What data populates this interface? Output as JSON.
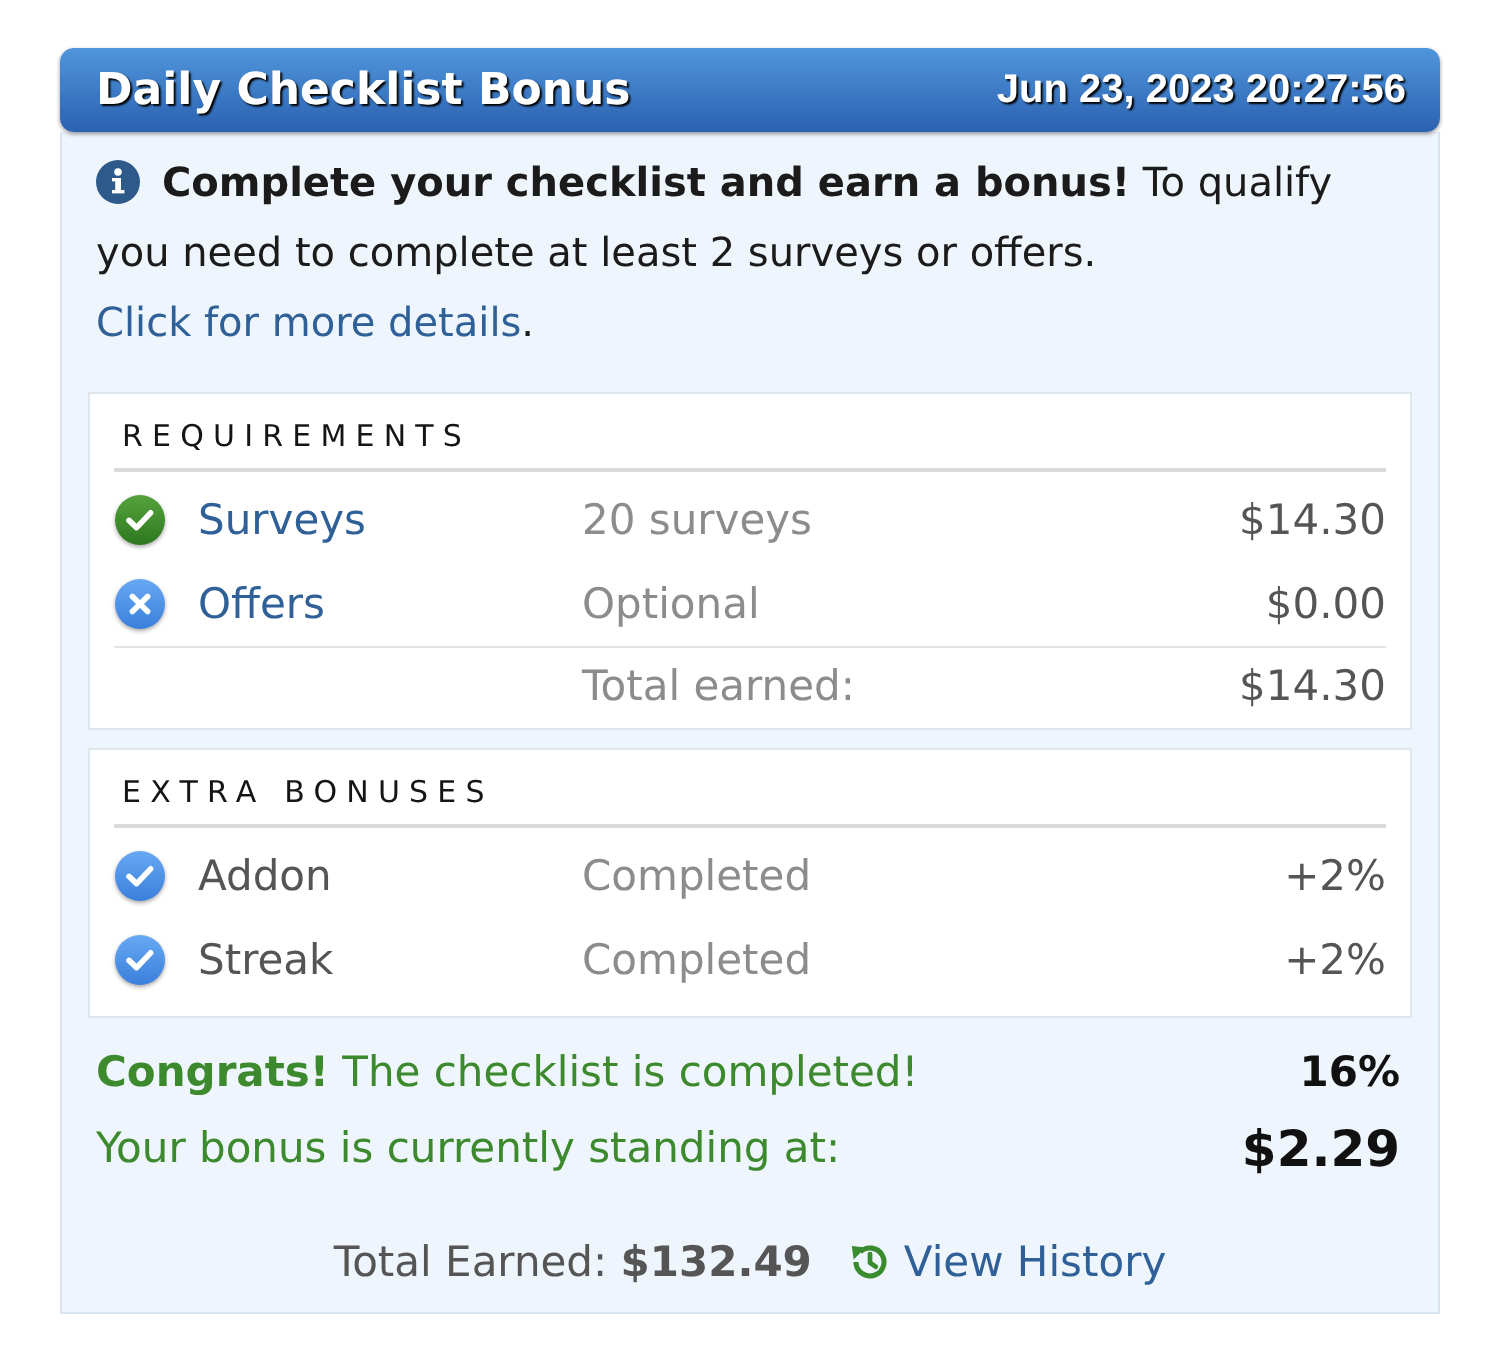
{
  "header": {
    "title": "Daily Checklist Bonus",
    "timestamp": "Jun 23, 2023 20:27:56"
  },
  "intro": {
    "text": "**Complete your checklist and earn a bonus!** To qualify you need to complete at least 2 surveys or offers.",
    "link": "Click for more details",
    "trailing": "."
  },
  "requirements": {
    "heading": "REQUIREMENTS",
    "rows": [
      {
        "name": "Surveys",
        "detail": "20 surveys",
        "amount": "$14.30",
        "completed": true
      },
      {
        "name": "Offers",
        "detail": "Optional",
        "amount": "$0.00",
        "completed": false
      }
    ],
    "total": {
      "label": "Total earned:",
      "amount": "$14.30"
    }
  },
  "extra_bonuses": {
    "heading": "EXTRA BONUSES",
    "rows": [
      {
        "name": "Addon",
        "detail": "Completed",
        "amount": "+2%",
        "completed": true
      },
      {
        "name": "Streak",
        "detail": "Completed",
        "amount": "+2%",
        "completed": true
      }
    ]
  },
  "summary": {
    "message": "**Congrats!** The checklist is completed!",
    "percent": "16%",
    "standing": "Your bonus is currently standing at:",
    "bonus": "$2.29"
  },
  "footer": {
    "total": "Total Earned: **$132.49**",
    "link": "View History"
  }
}
